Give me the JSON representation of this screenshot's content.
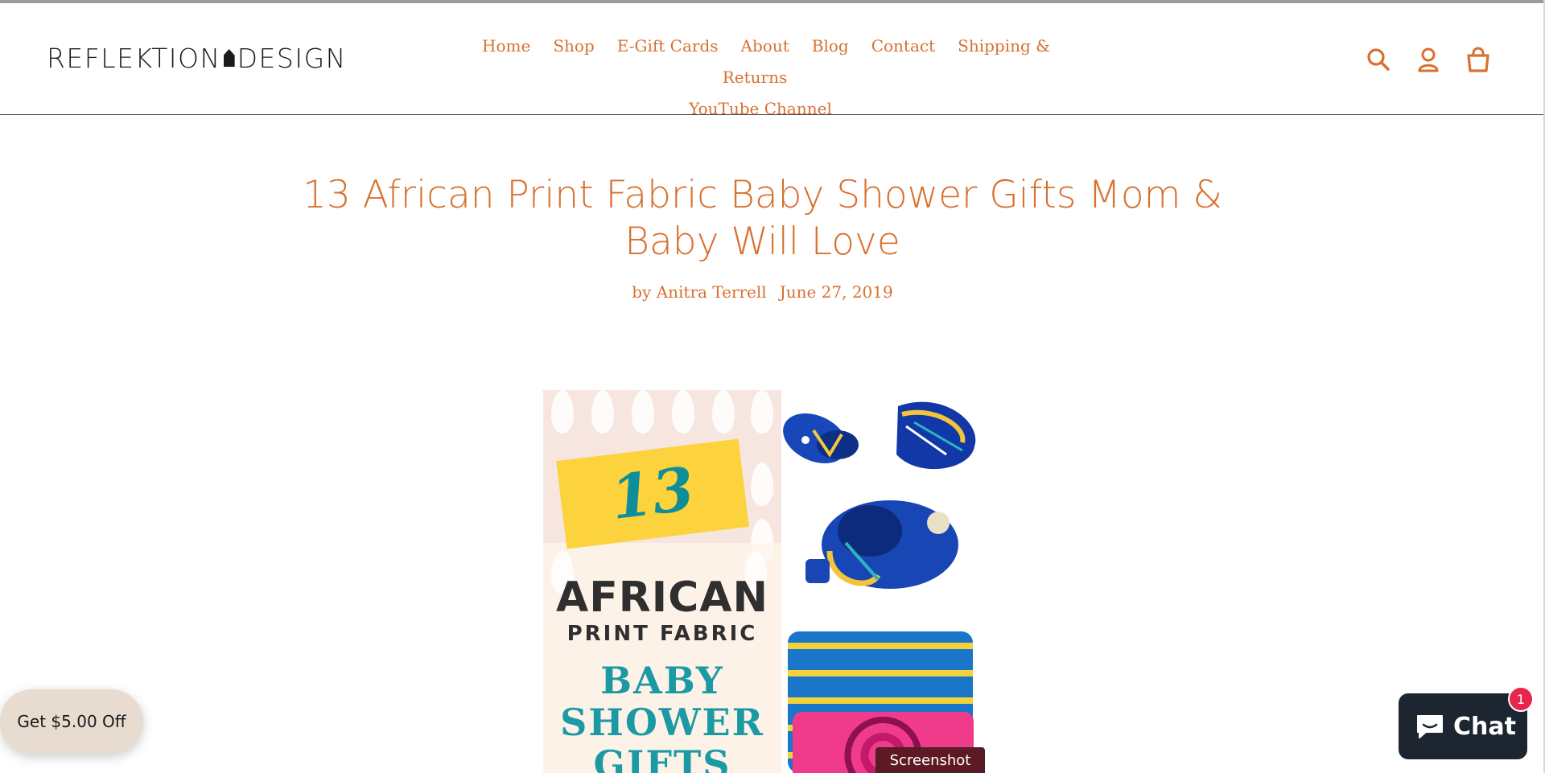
{
  "header": {
    "logo_text": "REFLEKTION DESIGN",
    "logo_left": "REFLEKTION",
    "logo_right": "DESIGN",
    "nav": [
      {
        "label": "Home"
      },
      {
        "label": "Shop"
      },
      {
        "label": "E-Gift Cards"
      },
      {
        "label": "About"
      },
      {
        "label": "Blog"
      },
      {
        "label": "Contact"
      },
      {
        "label": "Shipping & Returns"
      },
      {
        "label": "YouTube Channel"
      }
    ],
    "icons": [
      "search-icon",
      "account-icon",
      "cart-icon"
    ]
  },
  "article": {
    "title": "13 African Print Fabric Baby Shower Gifts Mom & Baby Will Love",
    "author": "by Anitra Terrell",
    "date": "June 27, 2019"
  },
  "hero_image": {
    "number": "13",
    "line1": "AFRICAN",
    "line2": "PRINT FABRIC",
    "line3": "BABY",
    "line4": "SHOWER",
    "line5": "GIFTS"
  },
  "widgets": {
    "offer_label": "Get $5.00 Off",
    "chat_label": "Chat",
    "chat_badge": "1",
    "screenshot_tag": "Screenshot"
  },
  "colors": {
    "accent": "#d9702f",
    "chat_bg": "#1d2630",
    "badge": "#e8254d",
    "offer_bg": "#e8dcd0"
  }
}
